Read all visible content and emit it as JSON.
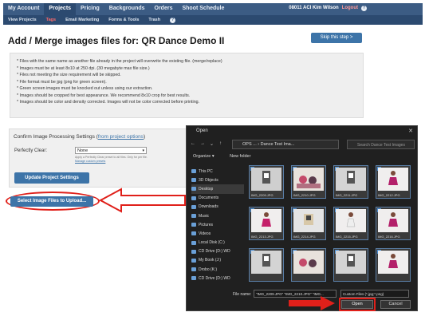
{
  "nav": {
    "tabs": [
      "My Account",
      "Projects",
      "Pricing",
      "Backgrounds",
      "Orders",
      "Shoot Schedule"
    ],
    "active_tab": "Projects",
    "subtabs": [
      "View Projects",
      "Tags",
      "Email Marketing",
      "Forms & Tools",
      "Trash"
    ],
    "user_text": "08011 ACI Kim Wilson",
    "logout": "Logout",
    "help": "?"
  },
  "page": {
    "title": "Add / Merge images files for: QR Dance Demo II",
    "skip_button": "Skip this step >"
  },
  "info_list": [
    "* Files with the same name as another file already in the project will overwrite the existing file. (merge/replace)",
    "* Images must be at least 8x10 at 250 dpi. (30 megabyte max file size.)",
    "* Files not meeting the size requirement will be skipped.",
    "* File format must be jpg (png for green screen).",
    "* Green screen images must be knocked out unless using our extraction.",
    "* Images should be cropped for best appearance. We recommend 8x10 crop for best results.",
    "* Images should be color and density corrected. Images will not be color corrected before printing."
  ],
  "settings": {
    "title": "Confirm Image Processing Settings",
    "link": "from project options",
    "perfectly_clear_label": "Perfectly Clear:",
    "perfectly_clear_value": "None",
    "help_text": "Apply a Perfectly Clear preset to all files. Only for per file.",
    "help_link": "Manage custom presets",
    "update_button": "Update Project Settings"
  },
  "select_button": "Select Image Files to Upload...",
  "dialog": {
    "title": "Open",
    "address": "OPS ... › Dance Test Ima...",
    "search_placeholder": "Search Dance Test Images",
    "organize": "Organize ▾",
    "new_folder": "New folder",
    "nav_items": [
      "This PC",
      "3D Objects",
      "Desktop",
      "Documents",
      "Downloads",
      "Music",
      "Pictures",
      "Videos",
      "Local Disk (C:)",
      "CD Drive (D:) WD",
      "My Book (J:)",
      "Drobo (K:)",
      "CD Drive (D:) WD"
    ],
    "files": [
      "IMG_2209.JPG",
      "IMG_2210.JPG",
      "IMG_2211.JPG",
      "IMG_2212.JPG",
      "IMG_2213.JPG",
      "IMG_2214.JPG",
      "IMG_2215.JPG",
      "IMG_2216.JPG",
      "",
      "",
      "",
      ""
    ],
    "file_name_label": "File name:",
    "file_name_value": "\"IMG_2209.JPG\" \"IMG_2210.JPG\" \"IMG...",
    "filter": "Custom Files (*.jpg;*.png)",
    "open_button": "Open",
    "cancel_button": "Cancel"
  },
  "colors": {
    "nav": "#3c5c84",
    "button": "#3d74a8",
    "highlight": "#e0201a"
  }
}
